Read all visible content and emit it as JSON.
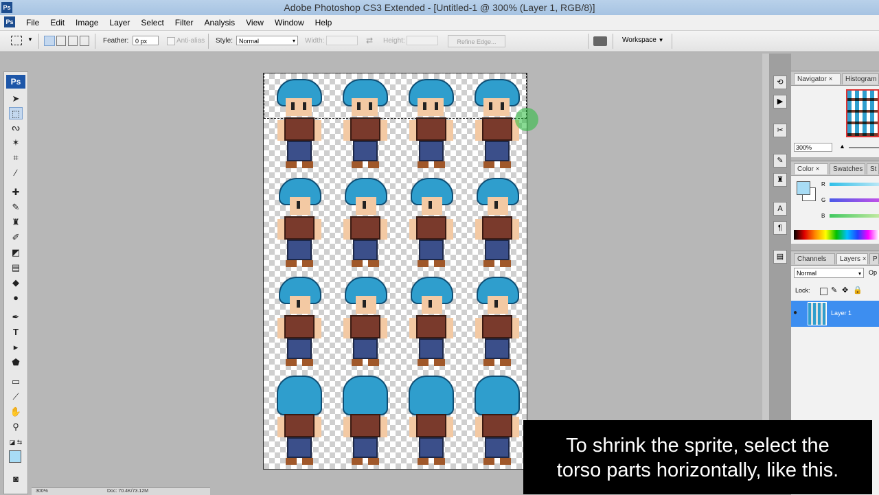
{
  "window": {
    "title": "Adobe Photoshop CS3 Extended - [Untitled-1 @ 300% (Layer 1, RGB/8)]",
    "badge": "Ps"
  },
  "menu": [
    "File",
    "Edit",
    "Image",
    "Layer",
    "Select",
    "Filter",
    "Analysis",
    "View",
    "Window",
    "Help"
  ],
  "options": {
    "feather_label": "Feather:",
    "feather_value": "0 px",
    "antialias_label": "Anti-alias",
    "style_label": "Style:",
    "style_value": "Normal",
    "width_label": "Width:",
    "height_label": "Height:",
    "refine_edge": "Refine Edge...",
    "workspace": "Workspace"
  },
  "toolbar": {
    "badge": "Ps"
  },
  "navigator": {
    "tabs": [
      "Navigator",
      "Histogram"
    ],
    "zoom": "300%"
  },
  "color": {
    "tabs": [
      "Color",
      "Swatches",
      "St"
    ],
    "channels": [
      "R",
      "G",
      "B"
    ],
    "fg_color": "#a8dcf5"
  },
  "layers": {
    "tabs": [
      "Channels",
      "Layers",
      "P"
    ],
    "blend": "Normal",
    "opacity_label": "Op",
    "lock_label": "Lock:",
    "layer_name": "Layer 1"
  },
  "status": {
    "zoom": "300%",
    "doc": "Doc: 70.4K/73.12M"
  },
  "sprites": {
    "hair": "#2f9ecd",
    "shirt": "#7a3a2c",
    "pants": "#3b4f8a",
    "skin": "#f3c9a3"
  },
  "caption": {
    "line1": "To shrink the sprite, select the",
    "line2": "torso parts horizontally, like this."
  }
}
